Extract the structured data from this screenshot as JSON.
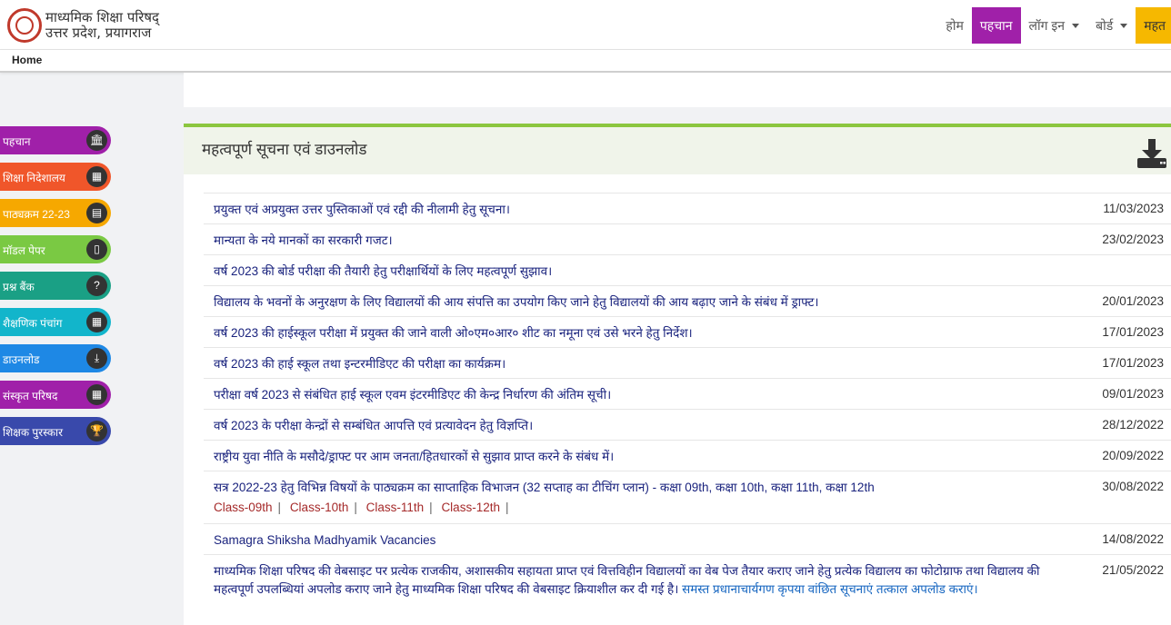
{
  "header": {
    "brand_line1": "माध्यमिक शिक्षा परिषद्",
    "brand_line2": "उत्तर प्रदेश, प्रयागराज",
    "nav": [
      {
        "label": "होम"
      },
      {
        "label": "पहचान"
      },
      {
        "label": "लॉग इन"
      },
      {
        "label": "बोर्ड"
      },
      {
        "label": "महत"
      }
    ]
  },
  "breadcrumb": {
    "home": "Home"
  },
  "sidebar": {
    "items": [
      {
        "label": "पहचान",
        "color": "#a020a9",
        "icon": "bank-icon"
      },
      {
        "label": "शिक्षा निदेशालय",
        "color": "#f0562a",
        "icon": "building-icon"
      },
      {
        "label": "पाठ्यक्रम 22-23",
        "color": "#f6a800",
        "icon": "book-icon"
      },
      {
        "label": "मॉडल पेपर",
        "color": "#7ac943",
        "icon": "file-icon"
      },
      {
        "label": "प्रश्न बैंक",
        "color": "#1aa085",
        "icon": "question-icon"
      },
      {
        "label": "शैक्षणिक पंचांग",
        "color": "#12b5cb",
        "icon": "calendar-icon"
      },
      {
        "label": "डाउनलोड",
        "color": "#1e88e5",
        "icon": "download-icon"
      },
      {
        "label": "संस्कृत परिषद",
        "color": "#a020a9",
        "icon": "building-icon"
      },
      {
        "label": "शिक्षक पुरस्कार",
        "color": "#3949ab",
        "icon": "trophy-icon"
      }
    ]
  },
  "notices": {
    "title": "महत्वपूर्ण सूचना एवं डाउनलोड",
    "icon": "download-tray-icon",
    "items": [
      {
        "title": "प्रयुक्त एवं अप्रयुक्त उत्तर पुस्तिकाओं एवं रद्दी की नीलामी हेतु सूचना।",
        "date": "11/03/2023"
      },
      {
        "title": "मान्यता के नये मानकों का सरकारी गजट।",
        "date": "23/02/2023"
      },
      {
        "title": "वर्ष 2023 की बोर्ड परीक्षा की तैयारी हेतु परीक्षार्थियों के लिए महत्वपूर्ण सुझाव।",
        "date": ""
      },
      {
        "title": "विद्यालय के भवनों के अनुरक्षण के लिए विद्यालयों की आय संपत्ति का उपयोग किए जाने हेतु विद्यालयों की आय बढ़ाए जाने के संबंध में ड्राफ्ट।",
        "date": "20/01/2023"
      },
      {
        "title": "वर्ष 2023 की हाईस्कूल परीक्षा में प्रयुक्त की जाने वाली ओ०एम०आर० शीट का नमूना एवं उसे भरने हेतु निर्देश।",
        "date": "17/01/2023"
      },
      {
        "title": "वर्ष 2023 की हाई स्कूल तथा इन्टरमीडिएट की परीक्षा का कार्यक्रम।",
        "date": "17/01/2023"
      },
      {
        "title": "परीक्षा वर्ष 2023 से संबंधित हाई स्कूल एवम इंटरमीडिएट की केन्द्र निर्धारण की अंतिम सूची।",
        "date": "09/01/2023"
      },
      {
        "title": "वर्ष 2023 के परीक्षा केन्द्रों से सम्बंधित आपत्ति एवं प्रत्यावेदन हेतु विज्ञप्ति।",
        "date": "28/12/2022"
      },
      {
        "title": "राष्ट्रीय युवा नीति के मसौदे/ड्राफ्ट पर आम जनता/हितधारकों से सुझाव प्राप्त करने के संबंध में।",
        "date": "20/09/2022"
      },
      {
        "title": "सत्र 2022-23 हेतु विभिन्न विषयों के पाठ्यक्रम का साप्ताहिक विभाजन (32 सप्ताह का टीचिंग प्लान) - कक्षा 09th, कक्षा 10th, कक्षा 11th, कक्षा 12th",
        "date": "30/08/2022",
        "links": [
          "Class-09th",
          "Class-10th",
          "Class-11th",
          "Class-12th"
        ]
      },
      {
        "title": "Samagra Shiksha Madhyamik Vacancies",
        "date": "14/08/2022"
      },
      {
        "title": "माध्यमिक शिक्षा परिषद की वेबसाइट पर प्रत्येक राजकीय, अशासकीय सहायता प्राप्त एवं वित्तविहीन विद्यालयों का वेब पेज तैयार कराए जाने हेतु प्रत्येक विद्यालय का फोटोग्राफ तथा विद्यालय की महत्वपूर्ण उपलब्धियां अपलोड कराए जाने हेतु माध्यमिक शिक्षा परिषद की वेबसाइट क्रियाशील कर दी गई है।",
        "title_extra": " समस्त प्रधानाचार्यगण कृपया वांछित सूचनाएं तत्काल अपलोड कराएं।",
        "date": "21/05/2022"
      }
    ]
  }
}
